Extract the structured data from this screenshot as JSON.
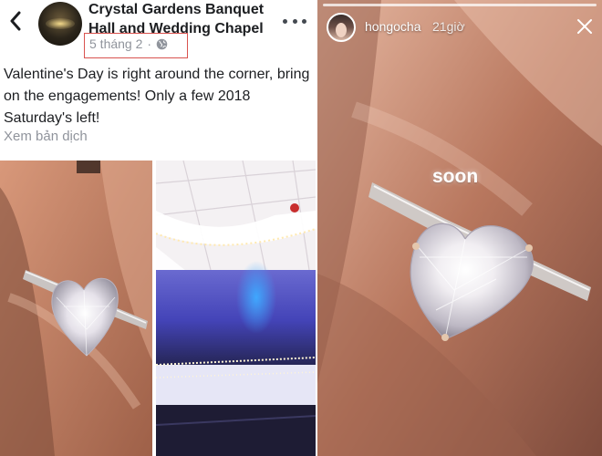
{
  "facebook_post": {
    "page_name": "Crystal Gardens Banquet Hall and Wedding Chapel",
    "date": "5 tháng 2",
    "separator": "·",
    "privacy_icon": "globe-icon",
    "post_text": "Valentine's Day is right around the corner, bring on the engagements! Only a few 2018 Saturday's left!",
    "see_translation": "Xem bản dịch",
    "back_icon": "chevron-left-icon",
    "more_icon": "more-horizontal-icon",
    "highlight_color": "#d9534f"
  },
  "instagram_story": {
    "username": "hongocha",
    "time": "21giờ",
    "sticker_text": "soon",
    "close_icon": "close-icon"
  }
}
